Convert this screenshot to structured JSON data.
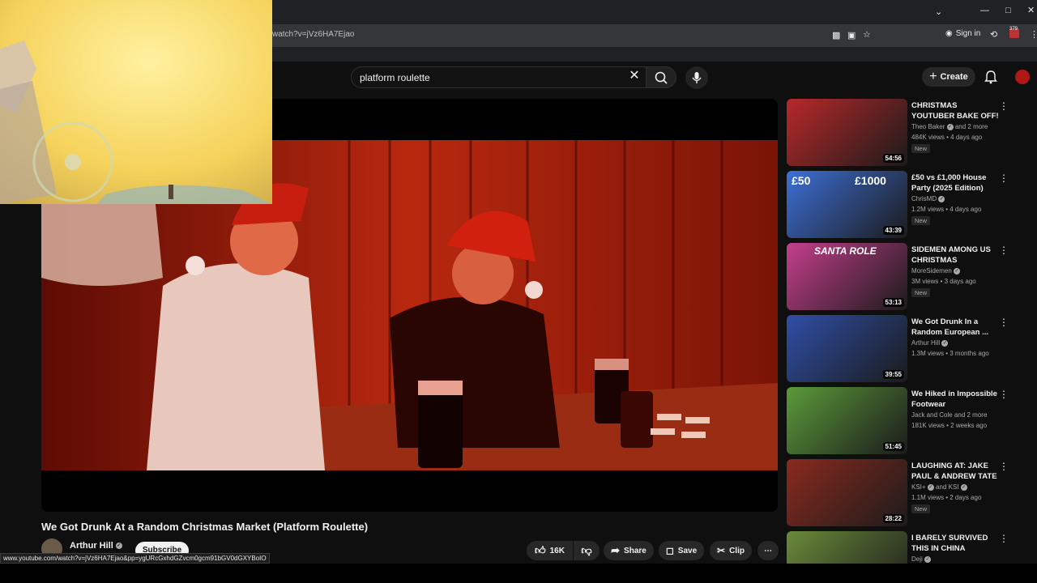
{
  "browser": {
    "url": "watch?v=jVz6HA7Ejao",
    "signin_label": "Sign in",
    "ext_badge": "379"
  },
  "search": {
    "query": "platform roulette"
  },
  "header": {
    "create_label": "Create"
  },
  "video": {
    "title": "We Got Drunk At a Random Christmas Market (Platform Roulette)",
    "channel": "Arthur Hill",
    "subscribe_label": "Subscribe",
    "likes": "16K",
    "share_label": "Share",
    "save_label": "Save",
    "clip_label": "Clip"
  },
  "status_bar": {
    "link": "www.youtube.com/watch?v=jVz6HA7Ejao&pp=ygURcGxhdGZvcm0gcm91bGV0dGXYBoIO"
  },
  "recommendations": [
    {
      "title": "CHRISTMAS YOUTUBER BAKE OFF!",
      "channel": "Theo Baker",
      "channel_extra": "and 2 more",
      "meta": "484K views • 4 days ago",
      "badge": "New",
      "duration": "54:56",
      "thumb_color": "#b8282a"
    },
    {
      "title": "£50 vs £1,000 House Party (2025 Edition)",
      "channel": "ChrisMD",
      "channel_extra": "",
      "meta": "1.2M views • 4 days ago",
      "badge": "New",
      "duration": "43:39",
      "thumb_color": "#3d6fd6",
      "thumb_text_left": "£50",
      "thumb_text_right": "£1000"
    },
    {
      "title": "SIDEMEN AMONG US CHRISTMAS SPECIAL...",
      "channel": "MoreSidemen",
      "channel_extra": "",
      "meta": "3M views • 3 days ago",
      "badge": "New",
      "duration": "53:13",
      "thumb_color": "#c43f8c",
      "thumb_text_left": "SANTA ROLE"
    },
    {
      "title": "We Got Drunk In a Random European ...",
      "channel": "Arthur Hill",
      "channel_extra": "",
      "meta": "1.3M views • 3 months ago",
      "badge": "",
      "duration": "39:55",
      "thumb_color": "#2f4fa6"
    },
    {
      "title": "We Hiked in Impossible Footwear",
      "channel": "Jack and Cole and 2 more",
      "channel_extra": "",
      "meta": "181K views • 2 weeks ago",
      "badge": "",
      "duration": "51:45",
      "thumb_color": "#5b9a3a"
    },
    {
      "title": "LAUGHING AT: JAKE PAUL & ANDREW TATE",
      "channel": "KSI+",
      "channel_extra": "and KSI",
      "meta": "1.1M views • 2 days ago",
      "badge": "New",
      "duration": "28:22",
      "thumb_color": "#8a2a1e"
    },
    {
      "title": "I BARELY SURVIVED THIS IN CHINA",
      "channel": "Deji",
      "channel_extra": "",
      "meta": "",
      "badge": "",
      "duration": "",
      "thumb_color": "#6a8a3a"
    }
  ]
}
